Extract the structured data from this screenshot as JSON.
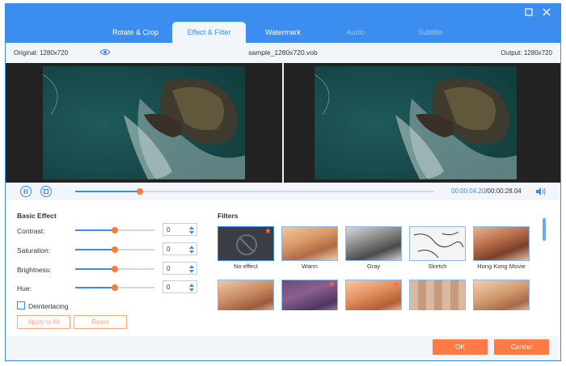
{
  "tabs": [
    {
      "label": "Rotate & Crop",
      "state": "normal"
    },
    {
      "label": "Effect & Filter",
      "state": "active"
    },
    {
      "label": "Watermark",
      "state": "normal"
    },
    {
      "label": "Audio",
      "state": "disabled"
    },
    {
      "label": "Subtitle",
      "state": "disabled"
    }
  ],
  "info": {
    "original": "Original: 1280x720",
    "file_name": "sample_1280x720.vob",
    "output": "Output: 1280x720"
  },
  "playback": {
    "progress_fraction": 0.18,
    "current_time": "00:00:04.20",
    "total_time": "/00:00:28.04"
  },
  "basic_effect": {
    "title": "Basic Effect",
    "rows": [
      {
        "label": "Contrast:",
        "value": "0",
        "level": 0.5
      },
      {
        "label": "Saturation:",
        "value": "0",
        "level": 0.5
      },
      {
        "label": "Brightness:",
        "value": "0",
        "level": 0.5
      },
      {
        "label": "Hue:",
        "value": "0",
        "level": 0.5
      }
    ],
    "deinterlacing_label": "Deinterlacing",
    "apply_all_label": "Apply to All",
    "reset_label": "Reset"
  },
  "filters": {
    "title": "Filters",
    "items": [
      {
        "label": "No effect",
        "type": "none",
        "star": true,
        "selected": true
      },
      {
        "label": "Warm",
        "type": "warm",
        "star": false
      },
      {
        "label": "Gray",
        "type": "gray",
        "star": false
      },
      {
        "label": "Sketch",
        "type": "sketch",
        "star": false
      },
      {
        "label": "Hong Kong Movie",
        "type": "hk",
        "star": false
      },
      {
        "label": "",
        "type": "warm2",
        "star": false
      },
      {
        "label": "",
        "type": "purple",
        "star": true
      },
      {
        "label": "",
        "type": "orange",
        "star": true
      },
      {
        "label": "",
        "type": "pixel",
        "star": false
      },
      {
        "label": "",
        "type": "plain",
        "star": false
      }
    ]
  },
  "footer": {
    "ok_label": "OK",
    "cancel_label": "Cancel"
  },
  "colors": {
    "accent": "#3b8ef0",
    "action": "#ff7a45"
  }
}
